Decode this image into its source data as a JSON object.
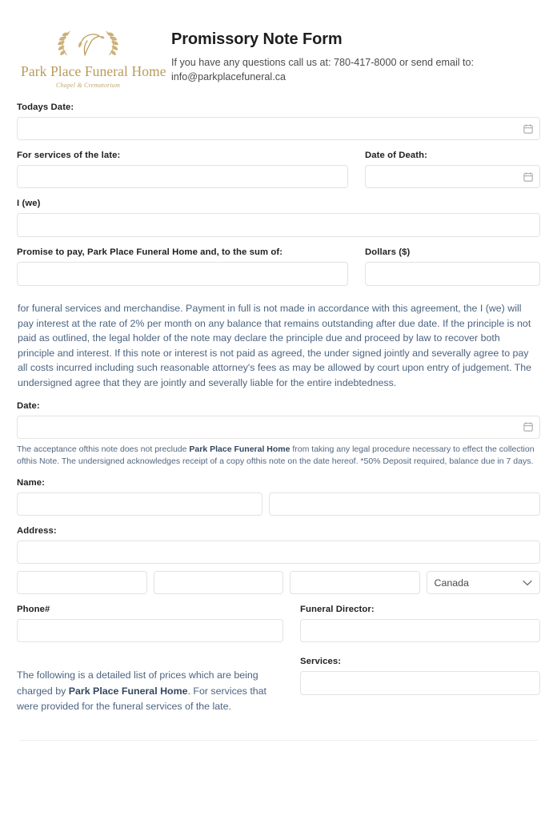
{
  "header": {
    "logo": {
      "icon": "dove-laurel-wreath-icon",
      "wordmark": "Park Place Funeral Home",
      "tagline": "Chapel & Crematorium",
      "gold": "#b99a5b"
    },
    "title": "Promissory Note Form",
    "subtitle": "If you have any questions call us at: 780-417-8000 or send email to: info@parkplacefuneral.ca"
  },
  "fields": {
    "todays_date": {
      "label": "Todays Date:",
      "value": "",
      "icon": "calendar-icon"
    },
    "services_of_late": {
      "label": "For services of the late:",
      "value": ""
    },
    "date_of_death": {
      "label": "Date of Death:",
      "value": "",
      "icon": "calendar-icon"
    },
    "i_we": {
      "label": "I (we)",
      "value": ""
    },
    "promise_to_pay": {
      "label": "Promise to pay, Park Place Funeral Home and, to the sum of:",
      "value": ""
    },
    "dollars": {
      "label": "Dollars ($)",
      "value": ""
    },
    "date": {
      "label": "Date:",
      "value": "",
      "icon": "calendar-icon"
    },
    "name": {
      "label": "Name:",
      "first_value": "",
      "last_value": ""
    },
    "address": {
      "label": "Address:",
      "street_value": "",
      "city_value": "",
      "region_value": "",
      "postal_value": "",
      "country_value": "Canada",
      "country_options": [
        "Canada"
      ],
      "chevron": "chevron-down-icon"
    },
    "phone": {
      "label": "Phone#",
      "value": ""
    },
    "funeral_director": {
      "label": "Funeral Director:",
      "value": ""
    },
    "services": {
      "label": "Services:",
      "value": ""
    }
  },
  "legal": {
    "paragraph": "for funeral services and merchandise. Payment in full is not made in accordance with this agreement, the I (we) will pay interest at the rate of 2% per month on any balance that remains outstanding after due date. If the principle is not paid as outlined, the legal holder of the note may declare the principle due and proceed by law to recover both principle and interest. If this note or interest is not paid as agreed, the under signed jointly and severally agree to pay all costs incurred including such reasonable attorney's fees as may be allowed by court upon entry of judgement. The undersigned agree that they are jointly and severally liable for the entire indebtedness.",
    "acceptance_part1": "The acceptance ofthis note does not preclude ",
    "acceptance_bold": "Park Place Funeral Home",
    "acceptance_part2": " from taking any legal procedure necessary to effect the collection ofthis Note. The undersigned acknowledges receipt of a copy ofthis note on the date hereof. *50% Deposit required, balance due in 7 days.",
    "pricing_part1": "The following is a detailed list of prices which are being charged by ",
    "pricing_bold": "Park Place Funeral Home",
    "pricing_part2": ". For services that were provided for the funeral services of the late."
  },
  "colors": {
    "legal_text": "#4c6480",
    "label_text": "#1f1f22",
    "field_border": "#e3e3e3",
    "brand_gold": "#b99a5b"
  }
}
